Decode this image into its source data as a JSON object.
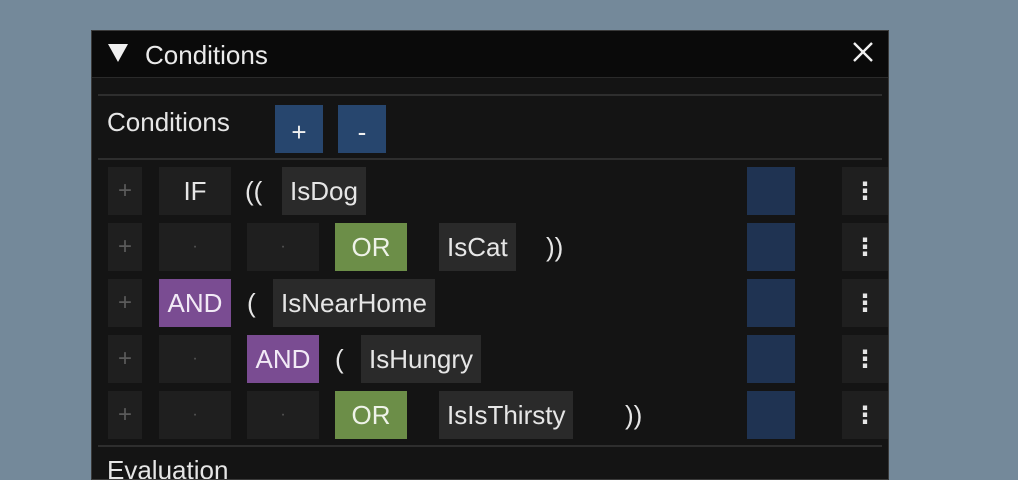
{
  "window": {
    "title": "Conditions",
    "close_symbol": "✕"
  },
  "toolbar": {
    "label": "Conditions",
    "add_label": "+",
    "remove_label": "-"
  },
  "rows": [
    {
      "plus": "+",
      "op": "IF",
      "op_type": "if",
      "open": "((",
      "name": "IsDog",
      "close": ""
    },
    {
      "plus": "+",
      "dot1": "·",
      "dot2": "·",
      "op": "OR",
      "op_type": "or",
      "name": "IsCat",
      "close": "))"
    },
    {
      "plus": "+",
      "op": "AND",
      "op_type": "and",
      "open": "(",
      "name": "IsNearHome",
      "close": ""
    },
    {
      "plus": "+",
      "dot1": "·",
      "op": "AND",
      "op_type": "and",
      "open": "(",
      "name": "IsHungry",
      "close": ""
    },
    {
      "plus": "+",
      "dot1": "·",
      "dot2": "·",
      "op": "OR",
      "op_type": "or",
      "name": "IsIsThirsty",
      "close": "))"
    }
  ],
  "kebab_symbol": "⋮",
  "next_section": {
    "label": "Evaluation"
  },
  "colors": {
    "background": "#74899a",
    "or": "#6c8e48",
    "and": "#7a4c92",
    "button": "#27466e",
    "slot": "#1f3352"
  }
}
